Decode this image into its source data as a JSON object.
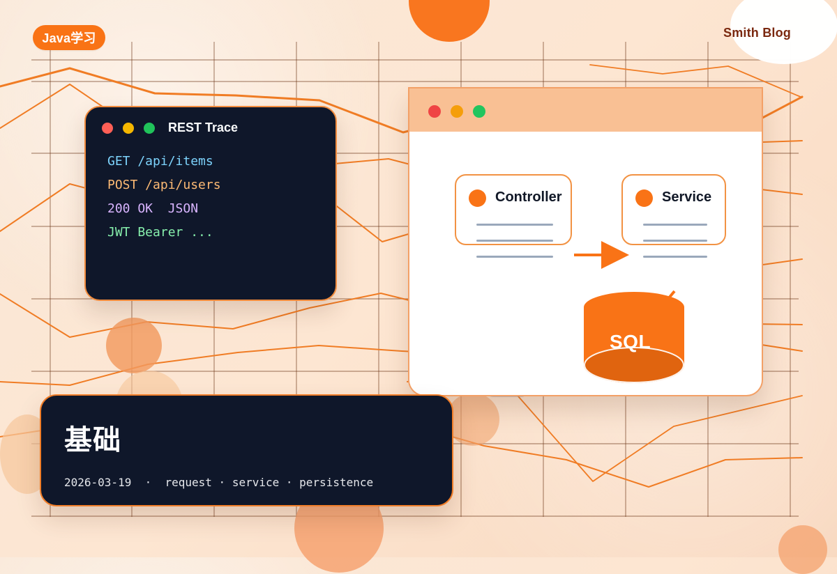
{
  "header": {
    "tag": "Java学习",
    "brand": "Smith Blog"
  },
  "terminal": {
    "title": "REST Trace",
    "lines": [
      "GET /api/items",
      "POST /api/users",
      "200 OK  JSON",
      "JWT Bearer ..."
    ]
  },
  "diagram": {
    "controller": "Controller",
    "service": "Service",
    "sql": "SQL"
  },
  "post": {
    "title": "基础",
    "meta": "2026-03-19  ·  request · service · persistence"
  },
  "colors": {
    "accent": "#f97316",
    "dark": "#0f172a",
    "brand": "#7a280f",
    "window_bar": "#f9c094",
    "connector": "#f97316"
  },
  "icons": [
    "red-window-dot",
    "yellow-window-dot",
    "green-window-dot",
    "orange-node-dot",
    "database-cylinder"
  ]
}
